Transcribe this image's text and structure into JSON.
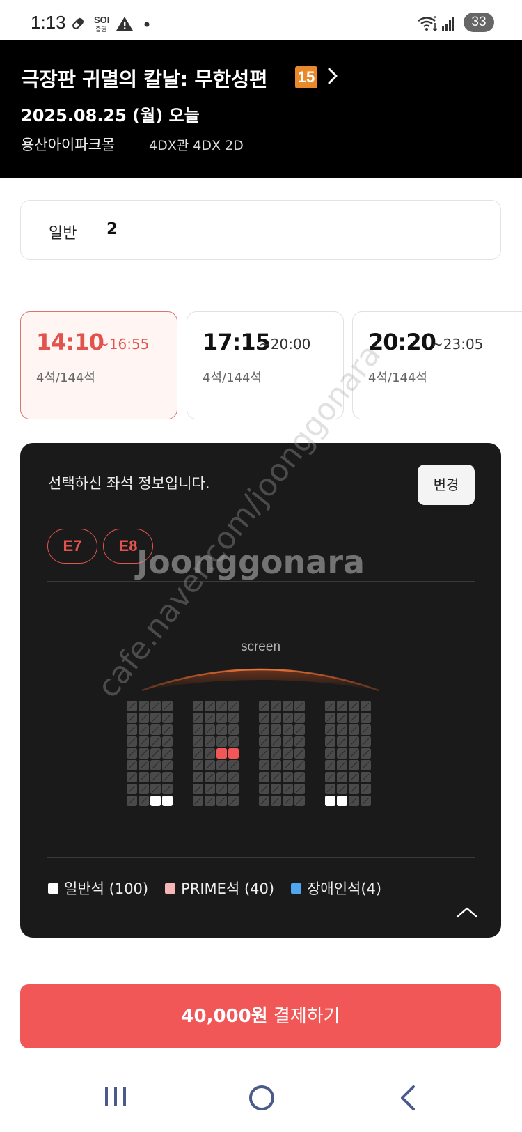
{
  "status_bar": {
    "time": "1:13",
    "battery": "33",
    "icons": [
      "pill-icon",
      "sol-app-icon",
      "warning-icon",
      "dot-icon",
      "wifi-icon",
      "signal-icon"
    ]
  },
  "header": {
    "title": "극장판 귀멸의 칼날: 무한성편",
    "age_rating": "15",
    "date": "2025.08.25 (월) 오늘",
    "theater": "용산아이파크몰",
    "hall": "4DX관 4DX 2D"
  },
  "ticket": {
    "label": "일반",
    "count": "2"
  },
  "showtimes": [
    {
      "start": "14:10",
      "end": "~16:55",
      "seats": "4석/144석",
      "selected": true
    },
    {
      "start": "17:15",
      "end": "~20:00",
      "seats": "4석/144석",
      "selected": false
    },
    {
      "start": "20:20",
      "end": "~23:05",
      "seats": "4석/144석",
      "selected": false
    }
  ],
  "seat_panel": {
    "info_text": "선택하신 좌석 정보입니다.",
    "change_label": "변경",
    "selected_seats": [
      "E7",
      "E8"
    ],
    "screen_label": "screen",
    "legend": [
      {
        "label": "일반석 (100)",
        "color": "#ffffff"
      },
      {
        "label": "PRIME석 (40)",
        "color": "#f4b6b6"
      },
      {
        "label": "장애인석(4)",
        "color": "#4fa8ef"
      }
    ],
    "colors": {
      "occupied": "#4a4a4a",
      "selected": "#f25757",
      "available": "#ffffff"
    }
  },
  "payment": {
    "price": "40,000원",
    "action": "결제하기"
  },
  "watermark": {
    "brand": "Joonggonara",
    "url": "cafe.naver.com/joonggonara"
  }
}
